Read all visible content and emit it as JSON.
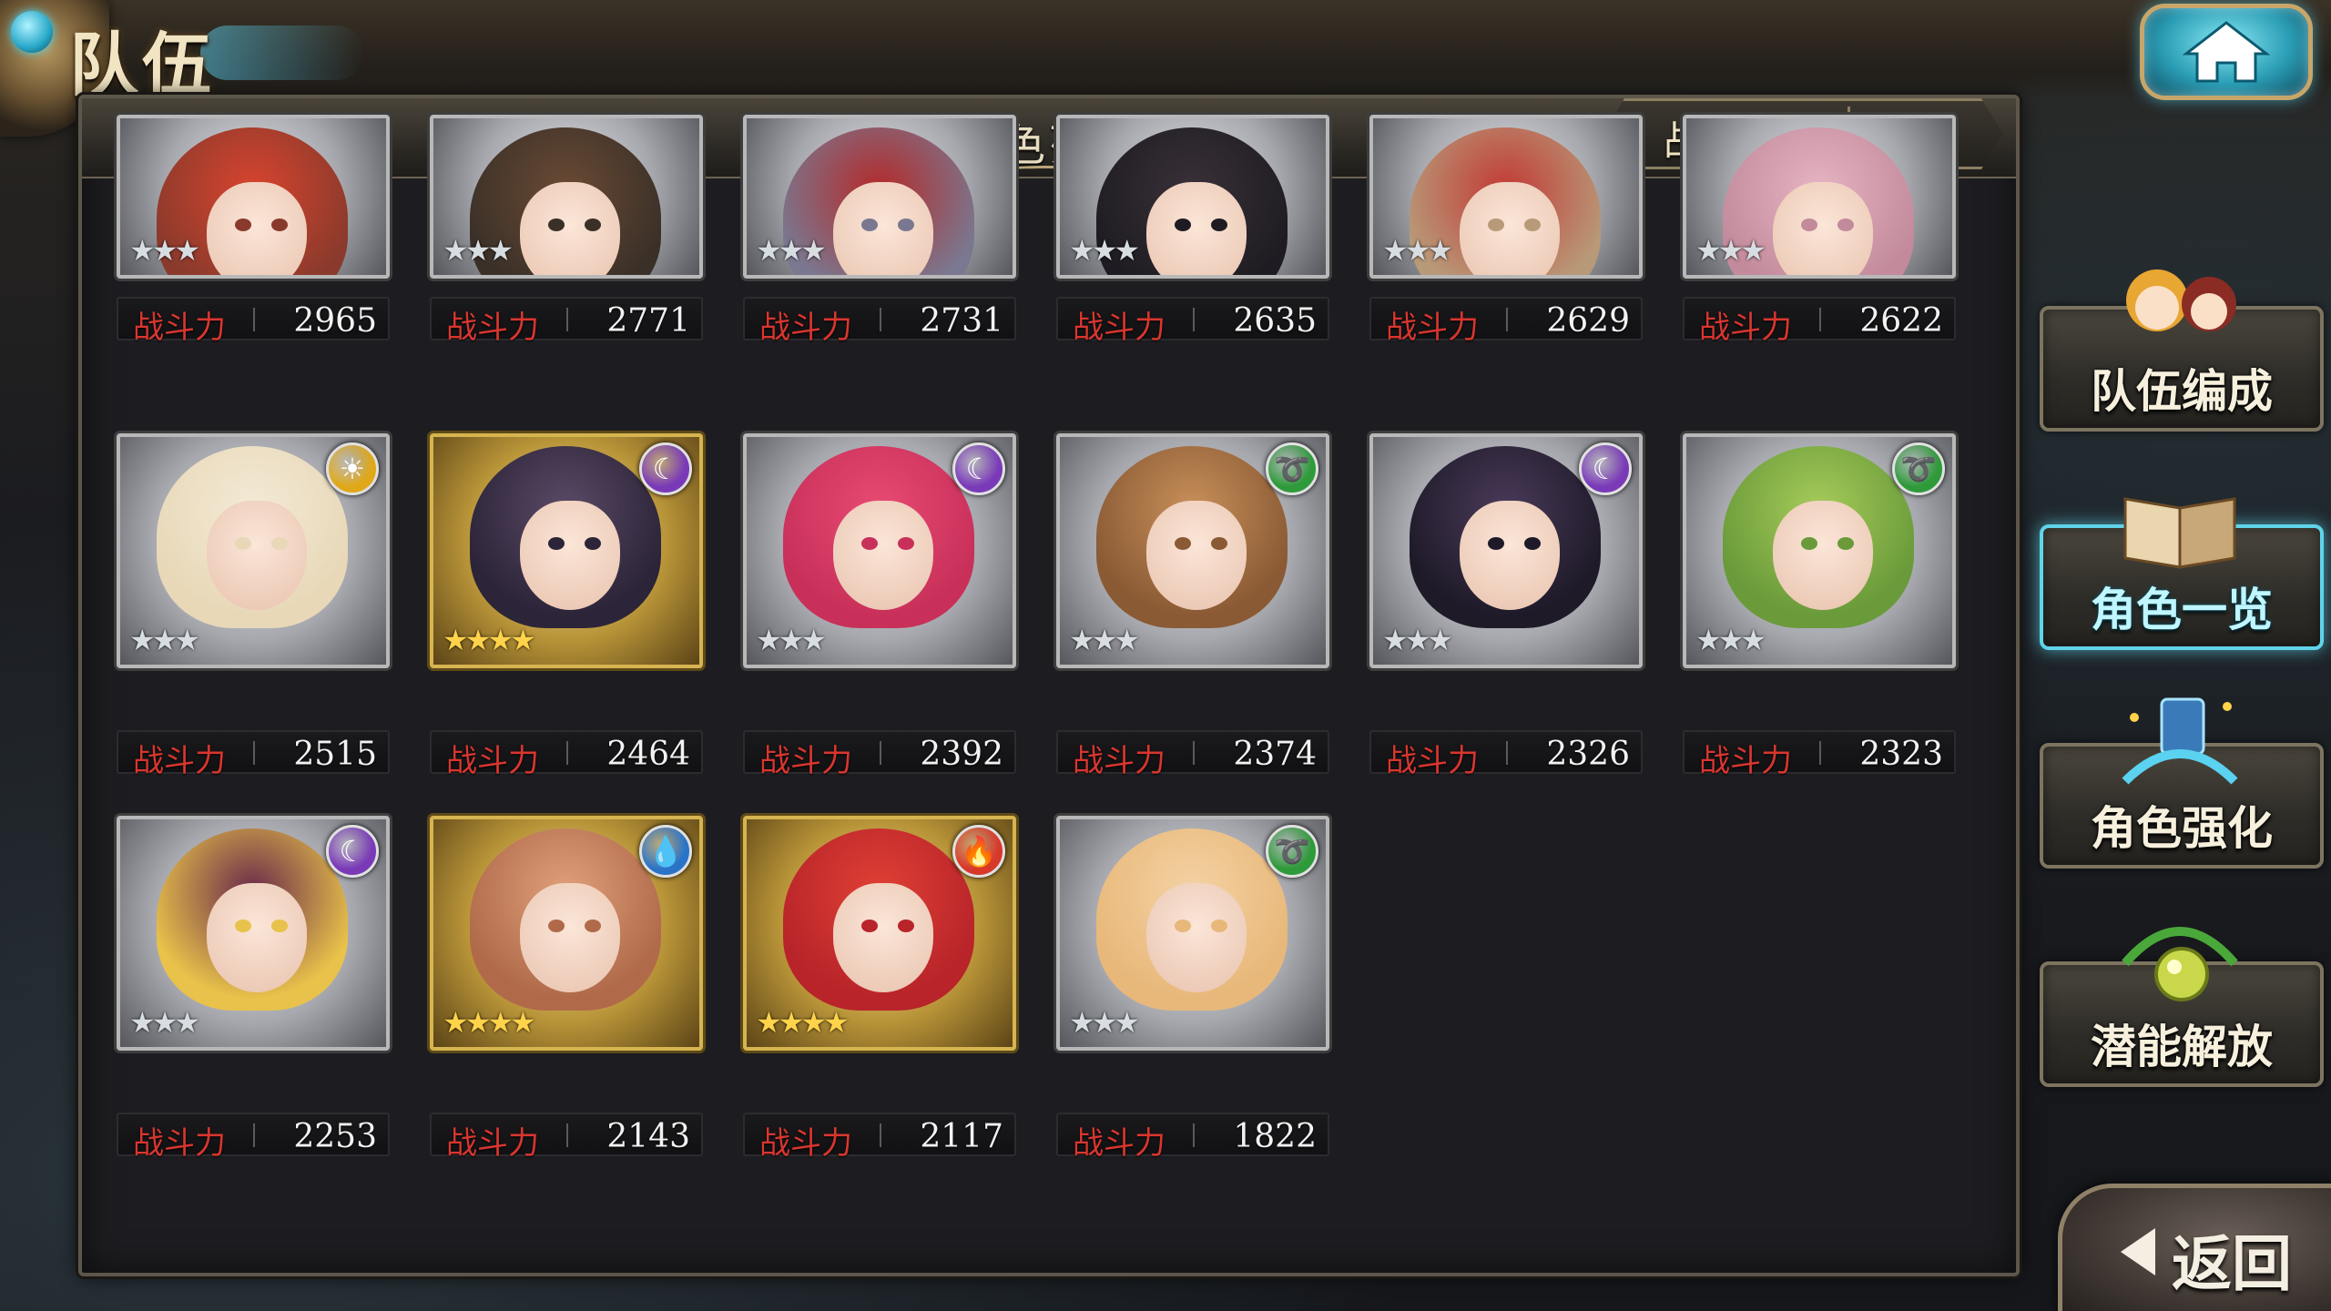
{
  "header": {
    "title": "队伍"
  },
  "panel": {
    "title": "角色列表",
    "sort": {
      "selected": "战斗力",
      "chevron_icon": "chevron-down-icon"
    }
  },
  "power_label": "战斗力",
  "characters": [
    {
      "power": "2965",
      "rarity": 3,
      "element": null,
      "palette": [
        "#8a3a2c",
        "#d8442e"
      ]
    },
    {
      "power": "2771",
      "rarity": 3,
      "element": null,
      "palette": [
        "#3a3028",
        "#6a4a34"
      ]
    },
    {
      "power": "2731",
      "rarity": 3,
      "element": null,
      "palette": [
        "#7a7890",
        "#b42a2a"
      ]
    },
    {
      "power": "2635",
      "rarity": 3,
      "element": null,
      "palette": [
        "#1e1c22",
        "#3a3038"
      ]
    },
    {
      "power": "2629",
      "rarity": 3,
      "element": null,
      "palette": [
        "#b89a78",
        "#c23a36"
      ]
    },
    {
      "power": "2622",
      "rarity": 3,
      "element": null,
      "palette": [
        "#c28a9a",
        "#e6b4c4"
      ]
    },
    {
      "power": "2515",
      "rarity": 3,
      "element": "sun",
      "palette": [
        "#e8d8b8",
        "#f3ead6"
      ]
    },
    {
      "power": "2464",
      "rarity": 4,
      "element": "moon",
      "palette": [
        "#2c2438",
        "#5a4a66"
      ]
    },
    {
      "power": "2392",
      "rarity": 3,
      "element": "moon",
      "palette": [
        "#c8305a",
        "#e84a72"
      ]
    },
    {
      "power": "2374",
      "rarity": 3,
      "element": "wind",
      "palette": [
        "#8a5a34",
        "#c8905a"
      ]
    },
    {
      "power": "2326",
      "rarity": 3,
      "element": "moon",
      "palette": [
        "#1e1a28",
        "#4a3a5a"
      ]
    },
    {
      "power": "2323",
      "rarity": 3,
      "element": "wind",
      "palette": [
        "#6a9a3a",
        "#a6cc5a"
      ]
    },
    {
      "power": "2253",
      "rarity": 3,
      "element": "moon",
      "palette": [
        "#e8c24a",
        "#6a2a4a"
      ]
    },
    {
      "power": "2143",
      "rarity": 4,
      "element": "water",
      "palette": [
        "#b06a4a",
        "#e0a07a"
      ]
    },
    {
      "power": "2117",
      "rarity": 4,
      "element": "fire",
      "palette": [
        "#b8242a",
        "#e04034"
      ]
    },
    {
      "power": "1822",
      "rarity": 3,
      "element": "wind",
      "palette": [
        "#e8b87a",
        "#f4d2a4"
      ]
    }
  ],
  "element_colors": {
    "sun": "#e0a818",
    "moon": "#7a3ab8",
    "wind": "#2e9a3a",
    "water": "#2a74c8",
    "fire": "#d8382a"
  },
  "element_glyphs": {
    "sun": "☀",
    "moon": "☾",
    "wind": "➰",
    "water": "💧",
    "fire": "🔥"
  },
  "side_menu": [
    {
      "label": "队伍编成",
      "icon": "team-members-icon",
      "active": false
    },
    {
      "label": "角色一览",
      "icon": "open-book-icon",
      "active": true
    },
    {
      "label": "角色强化",
      "icon": "enhance-crystal-icon",
      "active": false
    },
    {
      "label": "潜能解放",
      "icon": "potential-orb-icon",
      "active": false
    }
  ],
  "back_button": {
    "label": "返回",
    "icon": "back-arrow-icon"
  },
  "home_button": {
    "icon": "home-icon"
  },
  "colors": {
    "accent_cyan": "#5fd4ea",
    "power_label_red": "#d8362f",
    "sort_chevron_gold": "#f5c62c"
  }
}
